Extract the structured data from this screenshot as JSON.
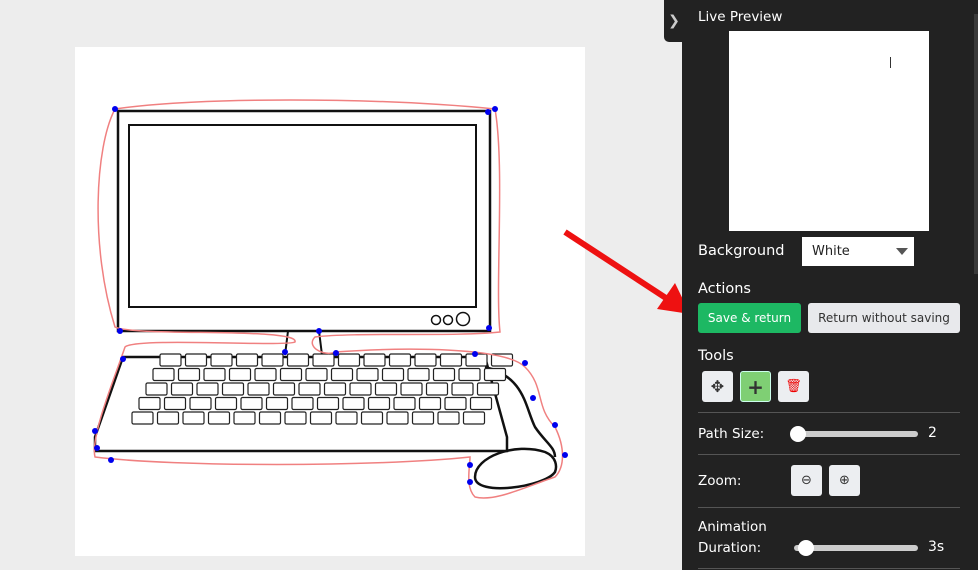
{
  "sidebar": {
    "toggle_icon": "chevron-right-icon",
    "live_preview": "Live Preview",
    "background_label": "Background",
    "background_value": "White",
    "actions_label": "Actions",
    "save_label": "Save & return",
    "return_label": "Return without saving",
    "tools_label": "Tools",
    "tools": [
      "move-icon",
      "plus-icon",
      "trash-icon"
    ],
    "path_size_label": "Path Size:",
    "path_size_value": "2",
    "zoom_label": "Zoom:",
    "animation_label": "Animation",
    "duration_label": "Duration:",
    "duration_value": "3s"
  },
  "colors": {
    "accent_green": "#1db863",
    "active_tool": "#7fcf74",
    "outline": "#f08080",
    "points": "#0000ee",
    "arrow": "#ee1111"
  }
}
